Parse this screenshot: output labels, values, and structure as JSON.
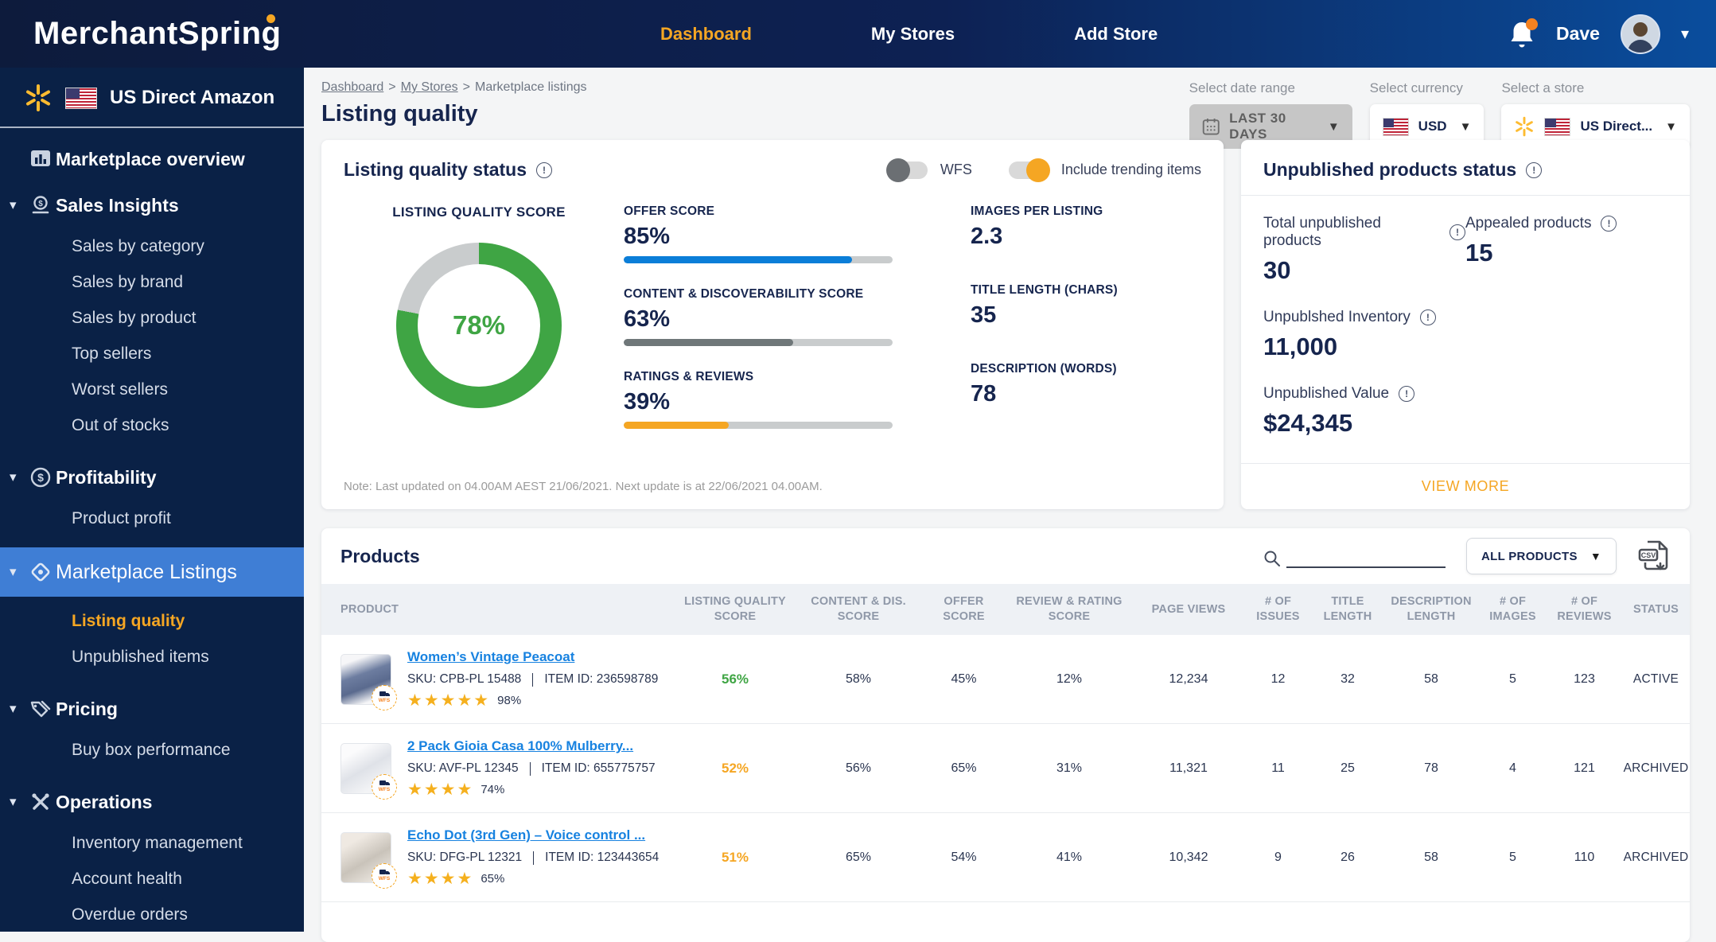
{
  "colors": {
    "accent_orange": "#f5a623",
    "green": "#3fa544",
    "blue_bar": "#0b7ed8",
    "gray_bar": "#6f7779",
    "track_gray": "#c9cccd",
    "link_blue": "#1782e0",
    "navy": "#16254e",
    "sidebar_active_blue": "#3f7ed5"
  },
  "topnav": {
    "logo": "MerchantSpring",
    "links": [
      {
        "label": "Dashboard",
        "active": true
      },
      {
        "label": "My Stores",
        "active": false
      },
      {
        "label": "Add Store",
        "active": false
      }
    ],
    "user_name": "Dave"
  },
  "sidebar": {
    "store_name": "US Direct Amazon",
    "sections": [
      {
        "label": "Marketplace overview",
        "children": []
      },
      {
        "label": "Sales Insights",
        "children": [
          "Sales by category",
          "Sales by brand",
          "Sales by product",
          "Top sellers",
          "Worst sellers",
          "Out of stocks"
        ]
      },
      {
        "label": "Profitability",
        "children": [
          "Product profit"
        ]
      },
      {
        "label": "Marketplace Listings",
        "children": [
          "Listing quality",
          "Unpublished items"
        ],
        "active": true,
        "active_child": "Listing quality"
      },
      {
        "label": "Pricing",
        "children": [
          "Buy box performance"
        ]
      },
      {
        "label": "Operations",
        "children": [
          "Inventory management",
          "Account health",
          "Overdue orders"
        ]
      }
    ]
  },
  "header": {
    "breadcrumb": {
      "items": [
        "Dashboard",
        "My Stores",
        "Marketplace listings"
      ],
      "separator": ">"
    },
    "title": "Listing quality",
    "date_range": {
      "label": "Select date range",
      "value": "LAST 30 DAYS"
    },
    "currency": {
      "label": "Select currency",
      "value": "USD"
    },
    "store": {
      "label": "Select a store",
      "value": "US Direct..."
    }
  },
  "listing_card": {
    "title": "Listing quality status",
    "toggles": [
      {
        "label": "WFS",
        "on": false
      },
      {
        "label": "Include trending items",
        "on": true
      }
    ],
    "donut": {
      "label": "LISTING QUALITY SCORE",
      "value_pct": 78,
      "display": "78%"
    },
    "metrics": [
      {
        "label": "OFFER SCORE",
        "display": "85%",
        "pct": 85,
        "color": "#0b7ed8"
      },
      {
        "label": "CONTENT & DISCOVERABILITY SCORE",
        "display": "63%",
        "pct": 63,
        "color": "#6f7779"
      },
      {
        "label": "RATINGS & REVIEWS",
        "display": "39%",
        "pct": 39,
        "color": "#f5a623"
      }
    ],
    "stats": [
      {
        "label": "IMAGES PER LISTING",
        "value": "2.3"
      },
      {
        "label": "TITLE LENGTH (CHARS)",
        "value": "35"
      },
      {
        "label": "DESCRIPTION (WORDS)",
        "value": "78"
      }
    ],
    "note": "Note: Last updated on 04.00AM AEST 21/06/2021. Next update is at 22/06/2021 04.00AM."
  },
  "unpublished_card": {
    "title": "Unpublished products status",
    "stats": [
      {
        "label": "Total unpublished products",
        "value": "30"
      },
      {
        "label": "Appealed products",
        "value": "15"
      },
      {
        "label": "Unpublshed Inventory",
        "value": "11,000"
      },
      {
        "label": "Unpublished Value",
        "value": "$24,345"
      }
    ],
    "view_more": "VIEW MORE"
  },
  "products": {
    "title": "Products",
    "filter_label": "ALL PRODUCTS",
    "export_icon_label": "CSV",
    "columns": [
      "PRODUCT",
      "LISTING QUALITY SCORE",
      "CONTENT & DIS. SCORE",
      "OFFER SCORE",
      "REVIEW & RATING SCORE",
      "PAGE VIEWS",
      "# OF ISSUES",
      "TITLE LENGTH",
      "DESCRIPTION LENGTH",
      "# OF IMAGES",
      "# OF REVIEWS",
      "STATUS"
    ],
    "rows": [
      {
        "title": "Women’s Vintage Peacoat",
        "sku": "SKU: CPB-PL 15488",
        "item_id": "ITEM ID: 236598789",
        "stars": 5,
        "rating": "98%",
        "badge": "WFS",
        "listing_quality": "56%",
        "lq_color": "#3fa544",
        "content_score": "58%",
        "offer_score": "45%",
        "review_score": "12%",
        "page_views": "12,234",
        "issues": "12",
        "title_length": "32",
        "description_length": "58",
        "images": "5",
        "reviews": "123",
        "status": "ACTIVE"
      },
      {
        "title": "2 Pack Gioia Casa 100% Mulberry...",
        "sku": "SKU: AVF-PL 12345",
        "item_id": "ITEM ID: 655775757",
        "stars": 4,
        "rating": "74%",
        "badge": "WFS",
        "listing_quality": "52%",
        "lq_color": "#f5a623",
        "content_score": "56%",
        "offer_score": "65%",
        "review_score": "31%",
        "page_views": "11,321",
        "issues": "11",
        "title_length": "25",
        "description_length": "78",
        "images": "4",
        "reviews": "121",
        "status": "ARCHIVED"
      },
      {
        "title": "Echo Dot (3rd Gen) – Voice control ...",
        "sku": "SKU: DFG-PL 12321",
        "item_id": "ITEM ID: 123443654",
        "stars": 4,
        "rating": "65%",
        "badge": "WFS",
        "listing_quality": "51%",
        "lq_color": "#f5a623",
        "content_score": "65%",
        "offer_score": "54%",
        "review_score": "41%",
        "page_views": "10,342",
        "issues": "9",
        "title_length": "26",
        "description_length": "58",
        "images": "5",
        "reviews": "110",
        "status": "ARCHIVED"
      }
    ]
  }
}
